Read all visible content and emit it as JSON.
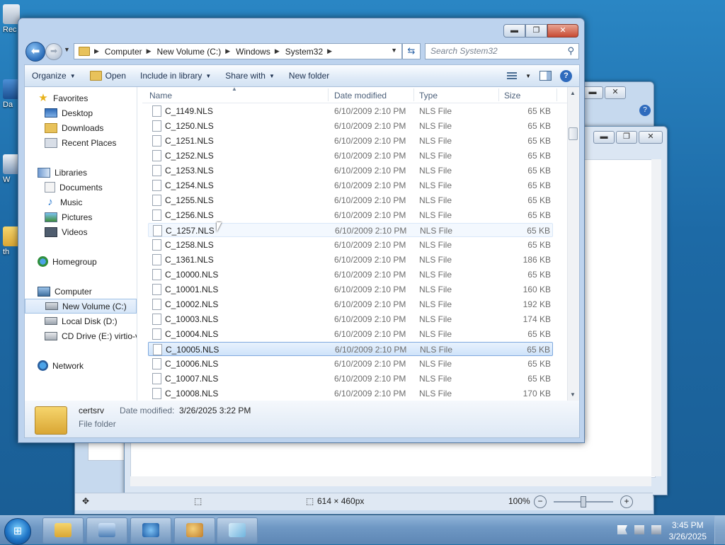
{
  "window": {
    "minimize": "▬",
    "maximize": "❐",
    "close": "✕"
  },
  "address": {
    "crumbs": [
      "Computer",
      "New Volume (C:)",
      "Windows",
      "System32"
    ],
    "search_placeholder": "Search System32"
  },
  "toolbar": {
    "organize": "Organize",
    "open": "Open",
    "include_in_library": "Include in library",
    "share_with": "Share with",
    "new_folder": "New folder"
  },
  "nav": {
    "favorites": "Favorites",
    "desktop": "Desktop",
    "downloads": "Downloads",
    "recent_places": "Recent Places",
    "libraries": "Libraries",
    "documents": "Documents",
    "music": "Music",
    "pictures": "Pictures",
    "videos": "Videos",
    "homegroup": "Homegroup",
    "computer": "Computer",
    "new_volume": "New Volume (C:)",
    "local_disk": "Local Disk (D:)",
    "cd_drive": "CD Drive (E:) virtio-v",
    "network": "Network"
  },
  "columns": {
    "name": "Name",
    "date_modified": "Date modified",
    "type": "Type",
    "size": "Size"
  },
  "files": [
    {
      "name": "C_1149.NLS",
      "date": "6/10/2009 2:10 PM",
      "type": "NLS File",
      "size": "65 KB"
    },
    {
      "name": "C_1250.NLS",
      "date": "6/10/2009 2:10 PM",
      "type": "NLS File",
      "size": "65 KB"
    },
    {
      "name": "C_1251.NLS",
      "date": "6/10/2009 2:10 PM",
      "type": "NLS File",
      "size": "65 KB"
    },
    {
      "name": "C_1252.NLS",
      "date": "6/10/2009 2:10 PM",
      "type": "NLS File",
      "size": "65 KB"
    },
    {
      "name": "C_1253.NLS",
      "date": "6/10/2009 2:10 PM",
      "type": "NLS File",
      "size": "65 KB"
    },
    {
      "name": "C_1254.NLS",
      "date": "6/10/2009 2:10 PM",
      "type": "NLS File",
      "size": "65 KB"
    },
    {
      "name": "C_1255.NLS",
      "date": "6/10/2009 2:10 PM",
      "type": "NLS File",
      "size": "65 KB"
    },
    {
      "name": "C_1256.NLS",
      "date": "6/10/2009 2:10 PM",
      "type": "NLS File",
      "size": "65 KB"
    },
    {
      "name": "C_1257.NLS",
      "date": "6/10/2009 2:10 PM",
      "type": "NLS File",
      "size": "65 KB"
    },
    {
      "name": "C_1258.NLS",
      "date": "6/10/2009 2:10 PM",
      "type": "NLS File",
      "size": "65 KB"
    },
    {
      "name": "C_1361.NLS",
      "date": "6/10/2009 2:10 PM",
      "type": "NLS File",
      "size": "186 KB"
    },
    {
      "name": "C_10000.NLS",
      "date": "6/10/2009 2:10 PM",
      "type": "NLS File",
      "size": "65 KB"
    },
    {
      "name": "C_10001.NLS",
      "date": "6/10/2009 2:10 PM",
      "type": "NLS File",
      "size": "160 KB"
    },
    {
      "name": "C_10002.NLS",
      "date": "6/10/2009 2:10 PM",
      "type": "NLS File",
      "size": "192 KB"
    },
    {
      "name": "C_10003.NLS",
      "date": "6/10/2009 2:10 PM",
      "type": "NLS File",
      "size": "174 KB"
    },
    {
      "name": "C_10004.NLS",
      "date": "6/10/2009 2:10 PM",
      "type": "NLS File",
      "size": "65 KB"
    },
    {
      "name": "C_10005.NLS",
      "date": "6/10/2009 2:10 PM",
      "type": "NLS File",
      "size": "65 KB"
    },
    {
      "name": "C_10006.NLS",
      "date": "6/10/2009 2:10 PM",
      "type": "NLS File",
      "size": "65 KB"
    },
    {
      "name": "C_10007.NLS",
      "date": "6/10/2009 2:10 PM",
      "type": "NLS File",
      "size": "65 KB"
    },
    {
      "name": "C_10008.NLS",
      "date": "6/10/2009 2:10 PM",
      "type": "NLS File",
      "size": "170 KB"
    }
  ],
  "selected_file": "C_10005.NLS",
  "hovered_file": "C_1257.NLS",
  "details": {
    "name": "certsrv",
    "modified_label": "Date modified:",
    "modified_value": "3/26/2025 3:22 PM",
    "type": "File folder"
  },
  "paint_status": {
    "dimensions": "614 × 460px",
    "zoom": "100%"
  },
  "taskbar": {
    "start_icon": "windows-logo",
    "time": "3:45 PM",
    "date": "3/26/2025"
  },
  "desktop_icons": [
    "Rec",
    "Da",
    "W",
    "th"
  ],
  "colors": {
    "accent": "#2a6cb8",
    "selection": "#cfe3fa",
    "close": "#c74a33"
  }
}
